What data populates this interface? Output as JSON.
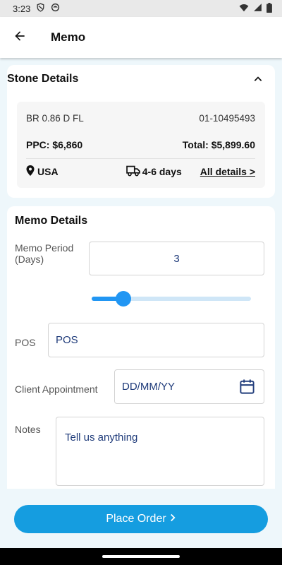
{
  "status_bar": {
    "time": "3:23",
    "icons": [
      "shield-icon",
      "circle-icon",
      "wifi-icon",
      "signal-icon",
      "battery-icon"
    ]
  },
  "app_bar": {
    "back_icon": "arrow-left-icon",
    "title": "Memo"
  },
  "stone_details": {
    "title": "Stone Details",
    "collapse_icon": "chevron-up-icon",
    "description": "BR 0.86 D FL",
    "stock_id": "01-10495493",
    "ppc": "PPC: $6,860",
    "total": "Total: $5,899.60",
    "location_icon": "location-pin-icon",
    "location": "USA",
    "shipping_icon": "truck-icon",
    "shipping": "4-6 days",
    "all_details_link": "All details >"
  },
  "memo_details": {
    "title": "Memo Details",
    "memo_period_label_line1": "Memo Period",
    "memo_period_label_line2": "(Days)",
    "memo_period_value": "3",
    "slider_fraction": 0.2,
    "pos_label": "POS",
    "pos_placeholder": "POS",
    "client_appointment_label": "Client Appointment",
    "client_appointment_placeholder": "DD/MM/YY",
    "calendar_icon": "calendar-icon",
    "notes_label": "Notes",
    "notes_placeholder": "Tell us anything"
  },
  "footer": {
    "place_order_label": "Place Order",
    "place_order_icon": "chevron-right-icon"
  },
  "colors": {
    "accent": "#159de0",
    "slider": "#2196f3",
    "background": "#eef7fb",
    "input_text": "#1f3b7a"
  }
}
